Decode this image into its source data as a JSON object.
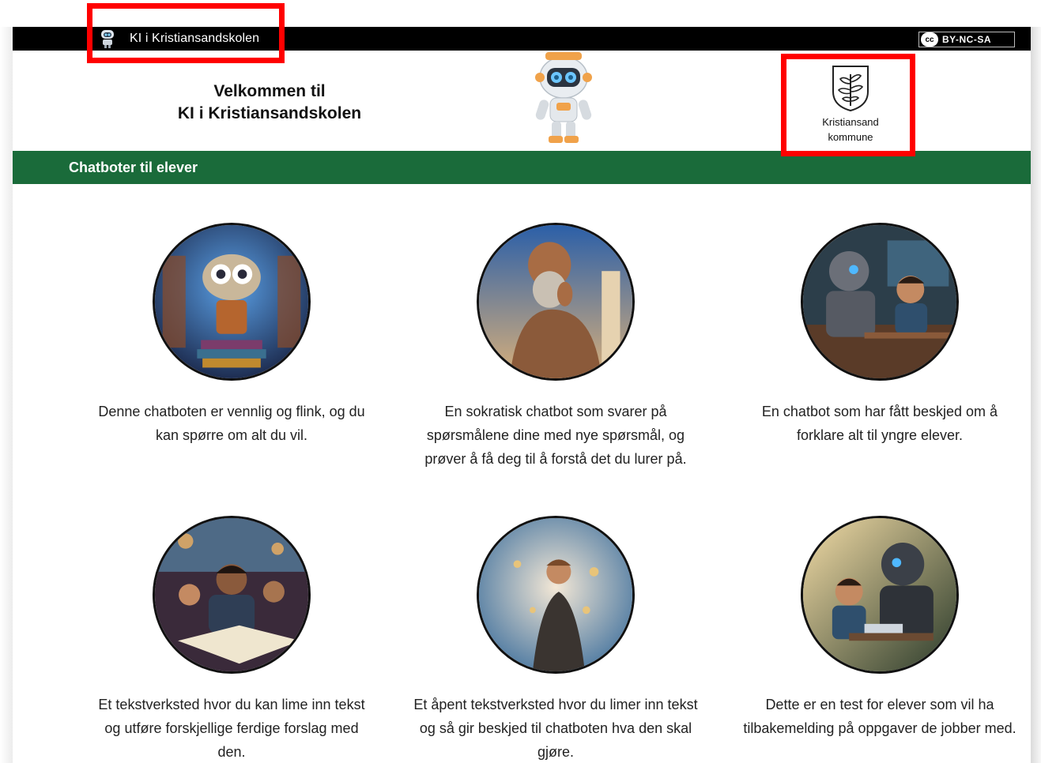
{
  "header": {
    "site_title": "KI i Kristiansandskolen",
    "license_badge": "BY-NC-SA",
    "cc_mark": "cc",
    "welcome_line1": "Velkommen til",
    "welcome_line2": "KI i Kristiansandskolen",
    "kommune_line1": "Kristiansand",
    "kommune_line2": "kommune"
  },
  "section": {
    "title": "Chatboter til elever"
  },
  "cards": [
    {
      "description": "Denne chatboten er vennlig og flink, og du kan spørre om alt du vil.",
      "image_icon": "friendly-robot-books-image"
    },
    {
      "description": "En sokratisk chatbot som svarer på spørsmålene dine med nye spørsmål, og prøver å få deg til å forstå det du lurer på.",
      "image_icon": "socrates-statue-image"
    },
    {
      "description": "En chatbot som har fått beskjed om å forklare alt til yngre elever.",
      "image_icon": "robot-and-boy-image"
    },
    {
      "description": "Et tekstverksted hvor du kan lime inn tekst og utføre forskjellige ferdige forslag med den.",
      "image_icon": "students-writing-image"
    },
    {
      "description": "Et åpent tekstverksted hvor du limer inn tekst og så gir beskjed til chatboten hva den skal gjøre.",
      "image_icon": "boy-looking-at-sky-image"
    },
    {
      "description": "Dette er en test for elever som vil ha tilbakemelding på oppgaver de jobber med.",
      "image_icon": "robot-helping-student-image"
    }
  ],
  "colors": {
    "topbar": "#000000",
    "section_bar": "#1a6b3a",
    "highlight": "#ff0000"
  }
}
